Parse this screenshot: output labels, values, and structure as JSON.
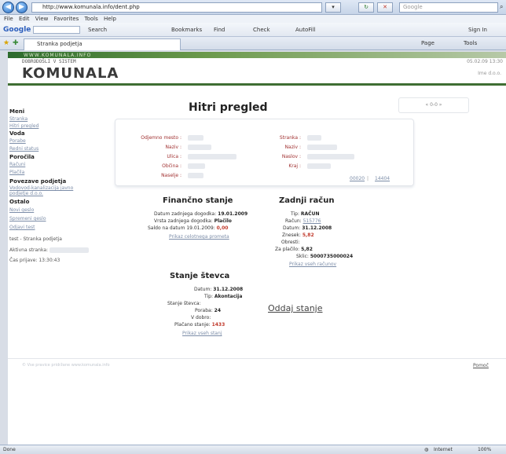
{
  "browser": {
    "url": "http://www.komunala.info/dent.php",
    "search_placeholder": "Google",
    "menu": [
      "File",
      "Edit",
      "View",
      "Favorites",
      "Tools",
      "Help"
    ],
    "google_label": "Google",
    "toolbar": {
      "search": "Search",
      "bookmarks": "Bookmarks",
      "find": "Find",
      "check": "Check",
      "autofill": "AutoFill",
      "sign_in": "Sign In",
      "page": "Page",
      "tools": "Tools"
    },
    "tab_title": "Stranka podjetja",
    "status_left": "Done",
    "status_zone": "Internet",
    "status_zoom": "100%"
  },
  "header": {
    "strip_text": "WWW.KOMUNALA.INFO",
    "welcome": "DOBRODOŠLI V        SISTEM",
    "brand": "KOMUNALA",
    "firm": "Ime d.o.o.",
    "datetime": "05.02.09 13:30"
  },
  "sidebar": {
    "meni": "Meni",
    "meni_items": [
      "Stranka",
      "Hitri pregled"
    ],
    "voda": "Voda",
    "voda_items": [
      "Porabe",
      "Redni status"
    ],
    "porocila": "Poročila",
    "porocila_items": [
      "Računi",
      "Plačila"
    ],
    "povezave": "Povezave podjetja",
    "povezave_items": [
      "Vodovod-kanalizacija javno",
      "podjetje d.o.o."
    ],
    "ostalo": "Ostalo",
    "ostalo_items": [
      "Novi geslo",
      "Spremeni geslo",
      "Odjavi test"
    ],
    "test_line": "test - Stranka podjetja",
    "aktivna": "Aktivna stranka:",
    "cas": "Čas prijave: 13:30:43"
  },
  "main": {
    "title": "Hitri pregled",
    "pager": "« 0-0 »",
    "info": {
      "left_labels": [
        "Odjemno mesto :",
        "Naziv :",
        "Ulica :",
        "Občina :",
        "Naselje :"
      ],
      "right_labels": [
        "Stranka :",
        "Naziv :",
        "Naslov :",
        "Kraj :"
      ],
      "codes": [
        "00020",
        "14404"
      ]
    },
    "financno": {
      "title": "Finančno stanje",
      "datum_label": "Datum zadnjega dogodka:",
      "datum_value": "19.01.2009",
      "vrsta_label": "Vrsta zadnjega dogodka:",
      "vrsta_value": "Plačilo",
      "saldo_label": "Saldo na datum 19.01.2009:",
      "saldo_value": "0,00",
      "link": "Prikaz celotnega prometa"
    },
    "racun": {
      "title": "Zadnji račun",
      "tip_label": "Tip:",
      "tip_value": "RAČUN",
      "racun_label": "Račun:",
      "racun_value": "515776",
      "datum_label": "Datum:",
      "datum_value": "31.12.2008",
      "znesek_label": "Znesek:",
      "znesek_value": "5,82",
      "obresti_label": "Obresti:",
      "obresti_value": "",
      "zaplacilo_label": "Za plačilo:",
      "zaplacilo_value": "5,82",
      "sklic_label": "Sklic:",
      "sklic_value": "5000735000024",
      "link": "Prikaz vseh računov"
    },
    "stevec": {
      "title": "Stanje števca",
      "datum_label": "Datum:",
      "datum_value": "31.12.2008",
      "tip_label": "Tip:",
      "tip_value": "Akontacija",
      "stanje_label": "Stanje števca:",
      "poraba_label": "Poraba:",
      "poraba_value": "24",
      "vdobro_label": "V dobro:",
      "placano_label": "Plačano stanje:",
      "placano_value": "1433",
      "link": "Prikaz vseh stanj"
    },
    "oddaj": "Oddaj stanje"
  },
  "footer": {
    "text": "© Vse pravice pridržane www.komunala.info",
    "link": "Pomoč"
  }
}
